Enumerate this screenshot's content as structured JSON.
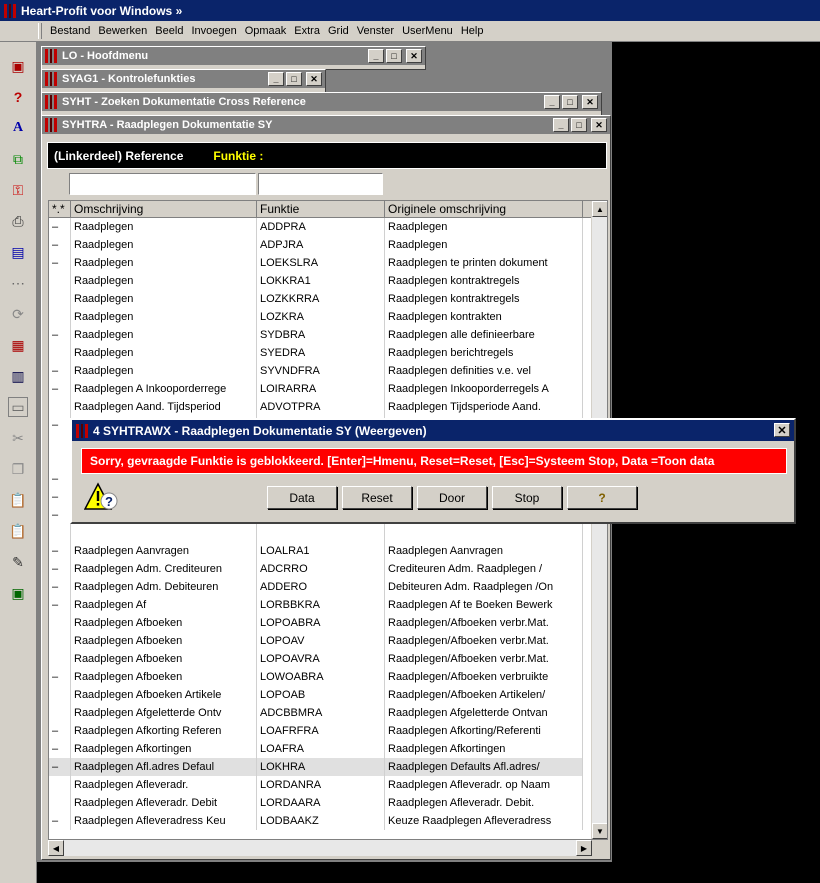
{
  "app": {
    "title": "Heart-Profit voor Windows  »"
  },
  "menu": [
    "Bestand",
    "Bewerken",
    "Beeld",
    "Invoegen",
    "Opmaak",
    "Extra",
    "Grid",
    "Venster",
    "UserMenu",
    "Help"
  ],
  "windows": {
    "lo": "LO - Hoofdmenu",
    "syag1": "SYAG1 - Kontrolefunkties",
    "syht": "SYHT - Zoeken Dokumentatie Cross Reference",
    "syhtra": "SYHTRA - Raadplegen Dokumentatie SY"
  },
  "ref_bar": {
    "label": "(Linkerdeel) Reference",
    "funktie": "Funktie :"
  },
  "grid": {
    "headers": [
      "*.*",
      "Omschrijving",
      "Funktie",
      "Originele omschrijving"
    ],
    "rows": [
      [
        "–",
        "Raadplegen",
        "ADDPRA",
        "Raadplegen"
      ],
      [
        "–",
        "Raadplegen",
        "ADPJRA",
        "Raadplegen"
      ],
      [
        "–",
        "Raadplegen",
        "LOEKSLRA",
        "Raadplegen te printen dokument"
      ],
      [
        "",
        "Raadplegen",
        "LOKKRA1",
        "Raadplegen kontraktregels"
      ],
      [
        "",
        "Raadplegen",
        "LOZKKRRA",
        "Raadplegen kontraktregels"
      ],
      [
        "",
        "Raadplegen",
        "LOZKRA",
        "Raadplegen kontrakten"
      ],
      [
        "–",
        "Raadplegen",
        "SYDBRA",
        "Raadplegen alle definieerbare"
      ],
      [
        "",
        "Raadplegen",
        "SYEDRA",
        "Raadplegen berichtregels"
      ],
      [
        "–",
        "Raadplegen",
        "SYVNDFRA",
        "Raadplegen definities v.e. vel"
      ],
      [
        "–",
        "Raadplegen A Inkooporderrege",
        "LOIRARRA",
        "Raadplegen Inkooporderregels A"
      ],
      [
        "",
        "Raadplegen Aand. Tijdsperiod",
        "ADVOTPRA",
        "Raadplegen Tijdsperiode Aand."
      ],
      [
        "–",
        "",
        "",
        ""
      ],
      [
        "",
        "",
        "",
        ""
      ],
      [
        "",
        "",
        "",
        ""
      ],
      [
        "–",
        "",
        "",
        ""
      ],
      [
        "–",
        "",
        "",
        ""
      ],
      [
        "–",
        "",
        "",
        ""
      ],
      [
        "",
        "",
        "",
        ""
      ],
      [
        "–",
        "Raadplegen Aanvragen",
        "LOALRA1",
        "Raadplegen Aanvragen"
      ],
      [
        "–",
        "Raadplegen Adm. Crediteuren",
        "ADCRRO",
        "Crediteuren Adm. Raadplegen /"
      ],
      [
        "–",
        "Raadplegen Adm. Debiteuren",
        "ADDERO",
        "Debiteuren Adm. Raadplegen /On"
      ],
      [
        "–",
        "Raadplegen Af",
        "LORBBKRA",
        "Raadplegen Af te Boeken Bewerk"
      ],
      [
        "",
        "Raadplegen Afboeken",
        "LOPOABRA",
        "Raadplegen/Afboeken verbr.Mat."
      ],
      [
        "",
        "Raadplegen Afboeken",
        "LOPOAV",
        "Raadplegen/Afboeken verbr.Mat."
      ],
      [
        "",
        "Raadplegen Afboeken",
        "LOPOAVRA",
        "Raadplegen/Afboeken verbr.Mat."
      ],
      [
        "–",
        "Raadplegen Afboeken",
        "LOWOABRA",
        "Raadplegen/Afboeken verbruikte"
      ],
      [
        "",
        "Raadplegen Afboeken Artikele",
        "LOPOAB",
        "Raadplegen/Afboeken Artikelen/"
      ],
      [
        "",
        "Raadplegen Afgeletterde Ontv",
        "ADCBBMRA",
        "Raadplegen Afgeletterde Ontvan"
      ],
      [
        "–",
        "Raadplegen Afkorting Referen",
        "LOAFRFRA",
        "Raadplegen Afkorting/Referenti"
      ],
      [
        "–",
        "Raadplegen Afkortingen",
        "LOAFRA",
        "Raadplegen Afkortingen"
      ],
      [
        "–",
        "Raadplegen Afl.adres  Defaul",
        "LOKHRA",
        "Raadplegen Defaults Afl.adres/"
      ],
      [
        "",
        "Raadplegen Afleveradr.",
        "LORDANRA",
        "Raadplegen Afleveradr. op Naam"
      ],
      [
        "",
        "Raadplegen Afleveradr. Debit",
        "LORDAARA",
        "Raadplegen Afleveradr. Debit."
      ],
      [
        "–",
        "Raadplegen Afleveradress Keu",
        "LODBAAKZ",
        "Keuze Raadplegen Afleveradress"
      ]
    ],
    "selected_row": 30
  },
  "dialog": {
    "title": "4 SYHTRAWX - Raadplegen Dokumentatie SY (Weergeven)",
    "message": "Sorry, gevraagde Funktie is geblokkeerd.  [Enter]=Hmenu, Reset=Reset, [Esc]=Systeem Stop, Data =Toon data",
    "buttons": {
      "data": "Data",
      "reset": "Reset",
      "door": "Door",
      "stop": "Stop",
      "help": "?"
    }
  },
  "colors": {
    "title_active": "#0a246a",
    "error_bg": "#ff0000",
    "funktie": "#ffff00"
  }
}
